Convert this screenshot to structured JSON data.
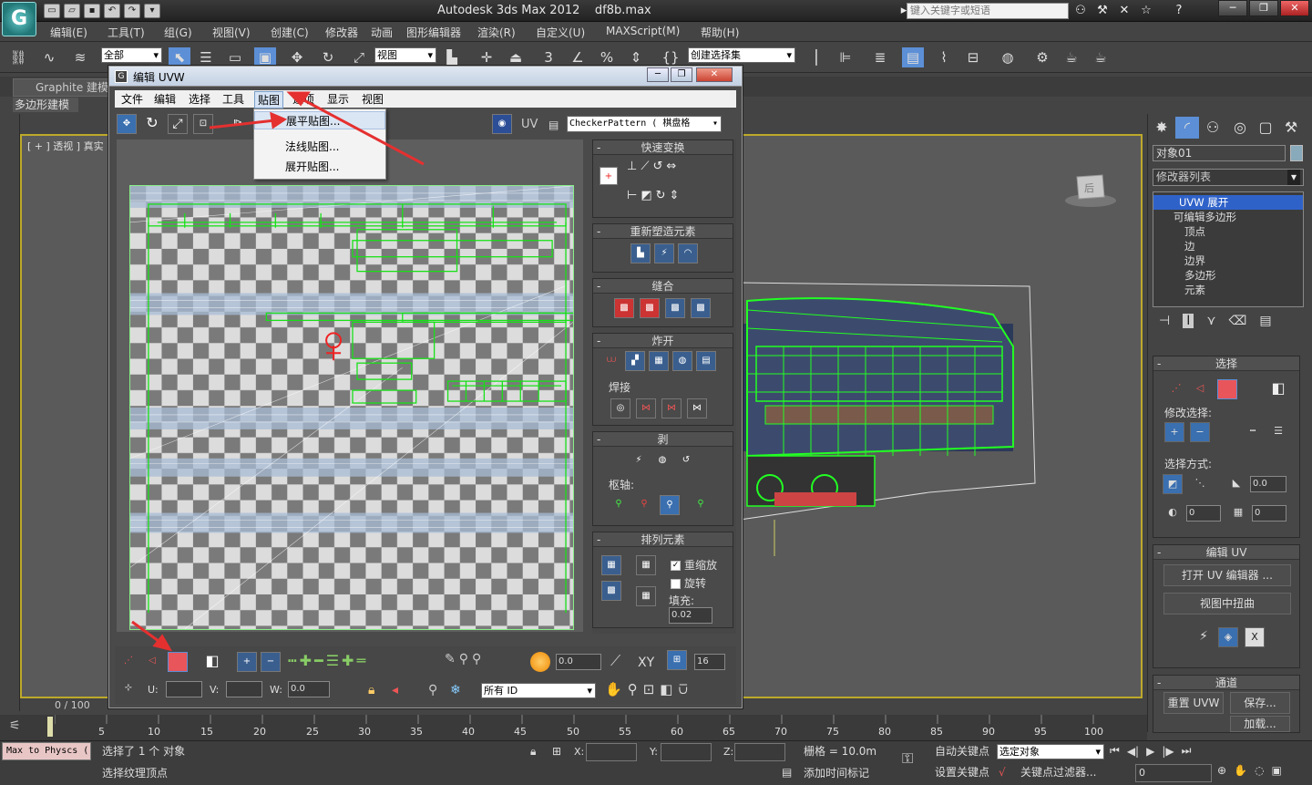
{
  "app": {
    "title": "Autodesk 3ds Max  2012",
    "file": "df8b.max",
    "search_placeholder": "键入关键字或短语",
    "window_buttons": [
      "─",
      "❐",
      "✕"
    ]
  },
  "menu": [
    "编辑(E)",
    "工具(T)",
    "组(G)",
    "视图(V)",
    "创建(C)",
    "修改器",
    "动画",
    "图形编辑器",
    "渲染(R)",
    "自定义(U)",
    "MAXScript(M)",
    "帮助(H)"
  ],
  "toolbar": {
    "filter": "全部",
    "ref_coord": "视图",
    "named_sel": "创建选择集",
    "snap_label": "3",
    "pct_label": "%"
  },
  "ribbon": {
    "tab": "Graphite 建模",
    "subtab": "多边形建模"
  },
  "viewport": {
    "label": "[ + ] 透视 ] 真实 ]",
    "cube_label": "后"
  },
  "timeline": {
    "frame": "0 / 100",
    "ticks": [
      "5",
      "10",
      "15",
      "20",
      "25",
      "30",
      "35",
      "40",
      "45",
      "50",
      "55",
      "60",
      "65",
      "70",
      "75",
      "80",
      "85",
      "90",
      "95",
      "100"
    ]
  },
  "status": {
    "script_field": "Max to Physcs (",
    "line1": "选择了 1 个 对象",
    "line2": "选择纹理顶点",
    "x_label": "X:",
    "y_label": "Y:",
    "z_label": "Z:",
    "grid": "栅格 = 10.0m",
    "auto_key": "自动关键点",
    "auto_key_sel": "选定对象",
    "set_key": "设置关键点",
    "key_filter": "关键点过滤器...",
    "add_time_tag": "添加时间标记",
    "frame_field": "0"
  },
  "cmd_panel": {
    "object_name": "对象01",
    "modifier_list": "修改器列表",
    "stack": [
      "UVW 展开",
      "可编辑多边形",
      "顶点",
      "边",
      "边界",
      "多边形",
      "元素"
    ],
    "sel_rollout": "选择",
    "modify_sel": "修改选择:",
    "sel_by": "选择方式:",
    "spin_a": "0.0",
    "spin_b": "0",
    "spin_c": "0",
    "edit_uv_rollout": "编辑 UV",
    "open_uv_editor": "打开 UV 编辑器 ...",
    "tweak_in_view": "视图中扭曲",
    "channel_rollout": "通道",
    "reset_uvw": "重置 UVW",
    "save": "保存...",
    "load": "加载..."
  },
  "uvw": {
    "title": "编辑 UVW",
    "menu": [
      "文件",
      "编辑",
      "选择",
      "工具",
      "贴图",
      "选项",
      "显示",
      "视图"
    ],
    "active_menu": "贴图",
    "uv_label": "UV",
    "checker_dd": "CheckerPattern  ( 棋盘格",
    "dropdown": [
      "展平贴图...",
      "法线贴图...",
      "展开贴图..."
    ],
    "quick_transform": "快速变换",
    "reshape": "重新塑造元素",
    "stitch": "缝合",
    "explode": "炸开",
    "weld": "焊接",
    "peel": "剥",
    "pivot": "枢轴:",
    "arrange": "排列元素",
    "rescale": "重缩放",
    "rotate": "旋转",
    "fill": "填充:",
    "fill_value": "0.02",
    "u_label": "U:",
    "v_label": "V:",
    "w_label": "W:",
    "w_value": "0.0",
    "spin_zero": "0.0",
    "xy": "XY",
    "num16": "16",
    "all_id": "所有 ID",
    "red_accent": "#e8555a"
  }
}
